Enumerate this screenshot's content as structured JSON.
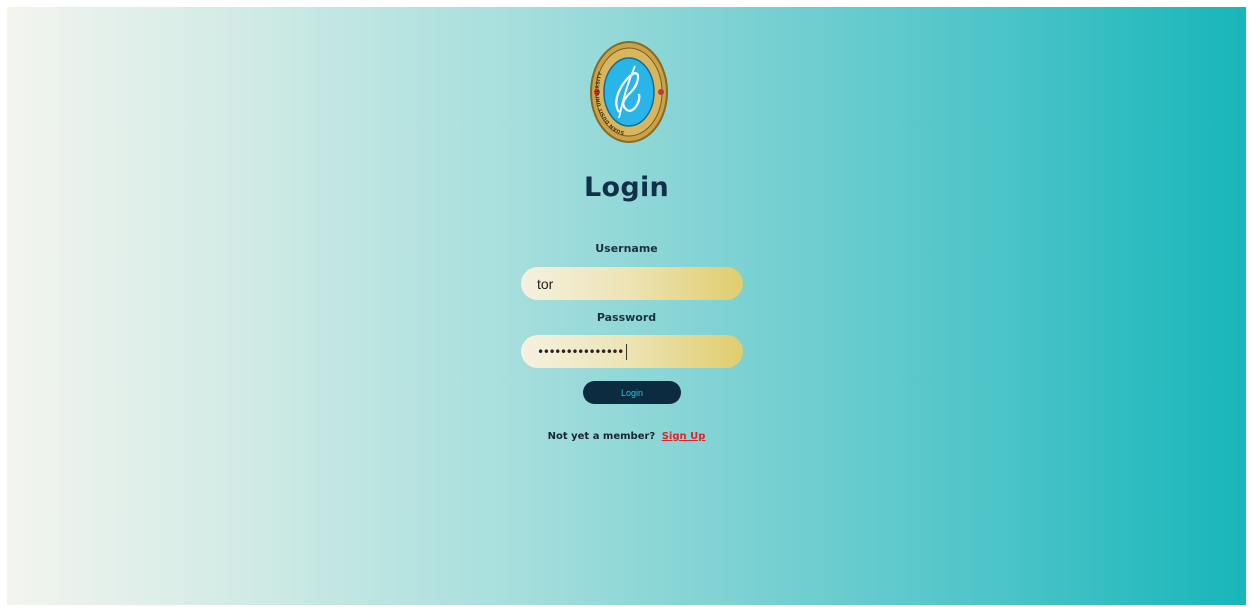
{
  "page": {
    "title": "Login"
  },
  "form": {
    "username_label": "Username",
    "username_value": "tor",
    "password_label": "Password",
    "password_masked": "•••••••••••••••",
    "submit_label": "Login"
  },
  "footer": {
    "prompt": "Not yet a member?",
    "link_label": "Sign Up"
  },
  "logo": {
    "icon": "university-seal-icon",
    "ring_text": "SUAN DUSIT UNIVERSITY"
  },
  "colors": {
    "title": "#13304a",
    "button_bg": "#0c2a40",
    "button_text": "#28c6d6",
    "link": "#e8202a",
    "gradient_left": "#f3f4ee",
    "gradient_right": "#17b6ba"
  }
}
